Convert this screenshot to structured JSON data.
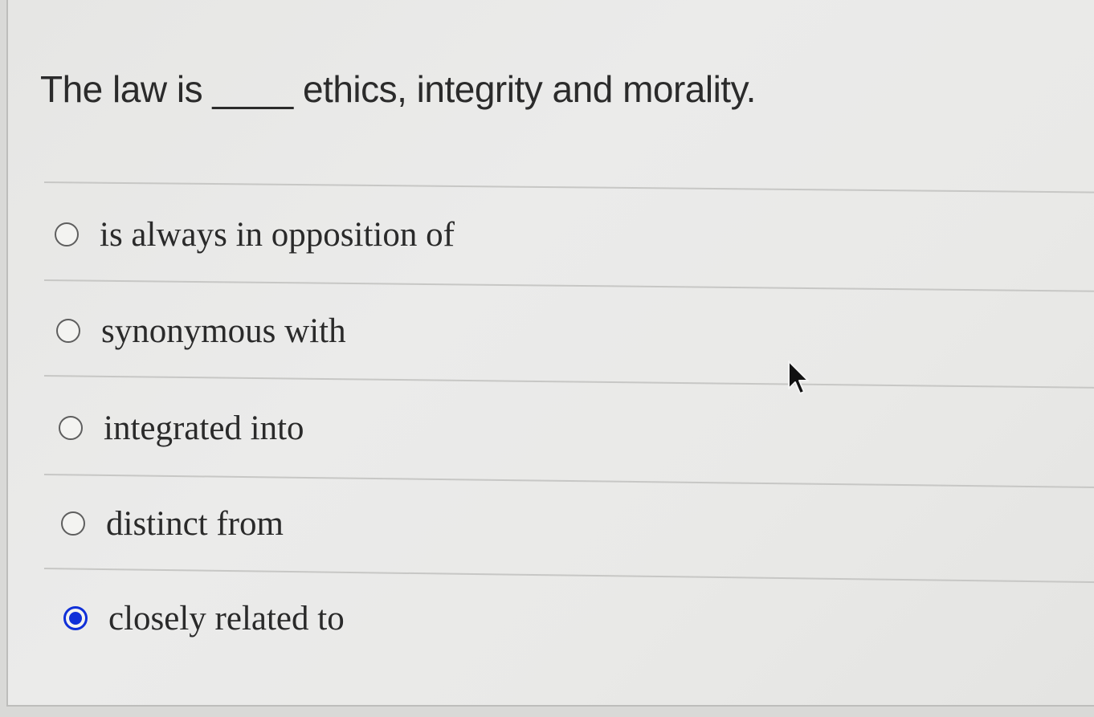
{
  "question": {
    "text": "The law is ____ ethics, integrity and morality."
  },
  "options": [
    {
      "label": "is always in opposition of",
      "selected": false
    },
    {
      "label": "synonymous with",
      "selected": false
    },
    {
      "label": "integrated into",
      "selected": false
    },
    {
      "label": "distinct from",
      "selected": false
    },
    {
      "label": "closely related to",
      "selected": true
    }
  ],
  "colors": {
    "selected_radio": "#1030d8",
    "background": "#e8e8e6"
  },
  "icons": {
    "cursor": "mouse-pointer-icon"
  }
}
